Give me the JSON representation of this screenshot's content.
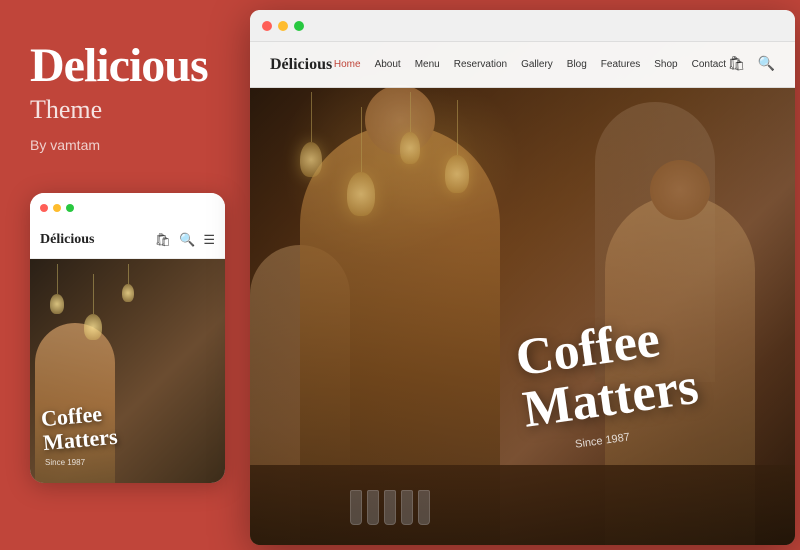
{
  "left_panel": {
    "title": "Delicious",
    "subtitle": "Theme",
    "author_label": "By vamtam"
  },
  "mobile_mockup": {
    "dots": [
      {
        "color": "#ff5f57"
      },
      {
        "color": "#febc2e"
      },
      {
        "color": "#28c840"
      }
    ],
    "logo": "Délicious",
    "overlay_text_line1": "Coffee",
    "overlay_text_line2": "Matters",
    "since_text": "Since 1987"
  },
  "browser": {
    "dots": [
      {
        "color": "#ff5f57"
      },
      {
        "color": "#febc2e"
      },
      {
        "color": "#28c840"
      }
    ]
  },
  "website": {
    "logo": "Délicious",
    "nav_items": [
      {
        "label": "Home",
        "active": true
      },
      {
        "label": "About"
      },
      {
        "label": "Menu"
      },
      {
        "label": "Reservation"
      },
      {
        "label": "Gallery"
      },
      {
        "label": "Blog"
      },
      {
        "label": "Features"
      },
      {
        "label": "Shop"
      },
      {
        "label": "Contact"
      }
    ],
    "hero_text_line1": "Coffee",
    "hero_text_line2": "Matters",
    "since_text": "Since 1987"
  }
}
